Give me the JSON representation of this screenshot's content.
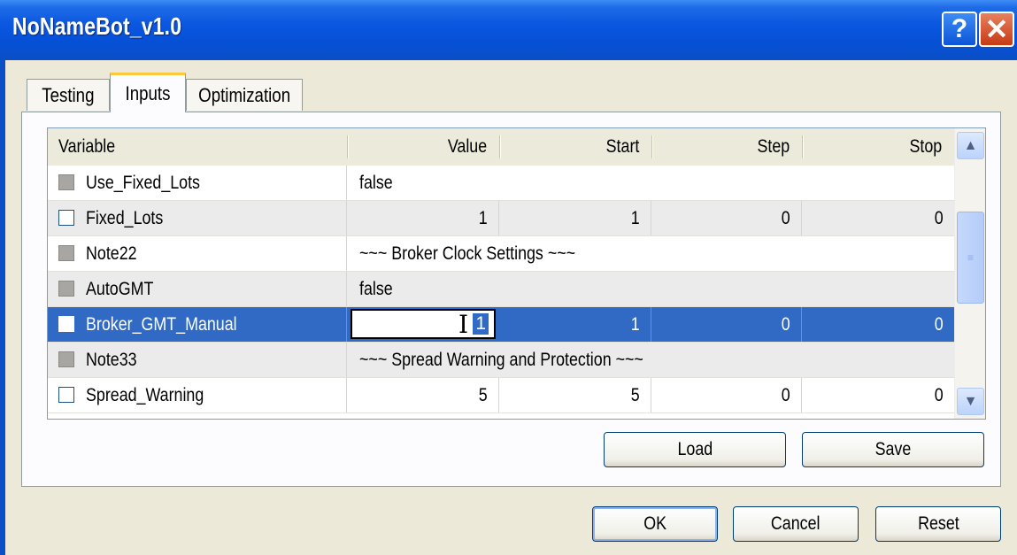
{
  "window": {
    "title": "NoNameBot_v1.0",
    "help_label": "?",
    "close_label": "✕"
  },
  "tabs": [
    {
      "label": "Testing"
    },
    {
      "label": "Inputs"
    },
    {
      "label": "Optimization"
    }
  ],
  "grid": {
    "columns": {
      "variable": "Variable",
      "value": "Value",
      "start": "Start",
      "step": "Step",
      "stop": "Stop"
    },
    "rows": [
      {
        "variable": "Use_Fixed_Lots",
        "value": "false",
        "checked": false,
        "checkbox_enabled": false
      },
      {
        "variable": "Fixed_Lots",
        "value": "1",
        "start": "1",
        "step": "0",
        "stop": "0",
        "checked": false,
        "checkbox_enabled": true
      },
      {
        "variable": "Note22",
        "value": "~~~ Broker Clock Settings ~~~",
        "checked": false,
        "checkbox_enabled": false
      },
      {
        "variable": "AutoGMT",
        "value": "false",
        "checked": false,
        "checkbox_enabled": false
      },
      {
        "variable": "Broker_GMT_Manual",
        "value": "1",
        "start": "1",
        "step": "0",
        "stop": "0",
        "checked": false,
        "checkbox_enabled": true,
        "selected": true,
        "editing": true
      },
      {
        "variable": "Note33",
        "value": "~~~ Spread Warning and Protection ~~~",
        "checked": false,
        "checkbox_enabled": false
      },
      {
        "variable": "Spread_Warning",
        "value": "5",
        "start": "5",
        "step": "0",
        "stop": "0",
        "checked": false,
        "checkbox_enabled": true
      }
    ]
  },
  "buttons": {
    "load": "Load",
    "save": "Save",
    "ok": "OK",
    "cancel": "Cancel",
    "reset": "Reset"
  },
  "colors": {
    "titlebar": "#0a57e0",
    "selection": "#316ac5",
    "active_tab_accent": "#ffc83c"
  }
}
